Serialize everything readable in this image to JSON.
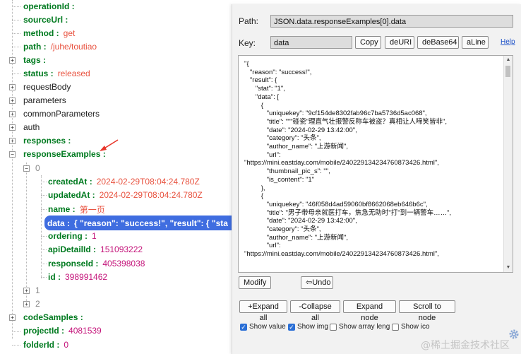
{
  "tree": {
    "operationId": {
      "key": "operationId :"
    },
    "sourceUrl": {
      "key": "sourceUrl :"
    },
    "method": {
      "key": "method :",
      "value": "get"
    },
    "path": {
      "key": "path :",
      "value": "/juhe/toutiao"
    },
    "tags": {
      "key": "tags :"
    },
    "status": {
      "key": "status :",
      "value": "released"
    },
    "requestBody": {
      "key": "requestBody"
    },
    "parameters": {
      "key": "parameters"
    },
    "commonParameters": {
      "key": "commonParameters"
    },
    "auth": {
      "key": "auth"
    },
    "responses": {
      "key": "responses :"
    },
    "responseExamples": {
      "key": "responseExamples :"
    },
    "index0": {
      "key": "0"
    },
    "createdAt": {
      "key": "createdAt :",
      "value": "2024-02-29T08:04:24.780Z"
    },
    "updatedAt": {
      "key": "updatedAt :",
      "value": "2024-02-29T08:04:24.780Z"
    },
    "name": {
      "key": "name :",
      "value": "第一页"
    },
    "data": {
      "key": "data :",
      "value": "{ \"reason\": \"success!\", \"result\": { \"sta"
    },
    "ordering": {
      "key": "ordering :",
      "value": "1"
    },
    "apiDetailId": {
      "key": "apiDetailId :",
      "value": "151093222"
    },
    "responseId": {
      "key": "responseId :",
      "value": "405398038"
    },
    "id": {
      "key": "id :",
      "value": "398991462"
    },
    "index1": {
      "key": "1"
    },
    "index2": {
      "key": "2"
    },
    "codeSamples": {
      "key": "codeSamples :"
    },
    "projectId": {
      "key": "projectId :",
      "value": "4081539"
    },
    "folderId": {
      "key": "folderId :",
      "value": "0"
    }
  },
  "panel": {
    "path_label": "Path:",
    "path_value": "JSON.data.responseExamples[0].data",
    "key_label": "Key:",
    "key_value": "data",
    "copy_button": "Copy",
    "deuri_button": "deURI",
    "debase64_button": "deBase64",
    "aline_button": "aLine",
    "help_link": "Help",
    "code_text": "\"{\n   \"reason\": \"success!\",\n   \"result\": {\n      \"stat\": \"1\",\n      \"data\": [\n         {\n            \"uniquekey\": \"9cf154de8302fab96c7ba5736d5ac068\",\n            \"title\": \"\"\"碰瓷\"理直气壮报警反称车被盗？真相让人啼笑皆非\",\n            \"date\": \"2024-02-29 13:42:00\",\n            \"category\": \"头条\",\n            \"author_name\": \"上游新闻\",\n            \"url\":\n\"https://mini.eastday.com/mobile/240229134234760873426.html\",\n            \"thumbnail_pic_s\": \"\",\n            \"is_content\": \"1\"\n         },\n         {\n            \"uniquekey\": \"46f058d4ad59060bf8662068eb646b6c\",\n            \"title\": \"男子带母亲就医打车，焦急无助时\"打\"到一辆警车……\",\n            \"date\": \"2024-02-29 13:42:00\",\n            \"category\": \"头条\",\n            \"author_name\": \"上游新闻\",\n            \"url\":\n\"https://mini.eastday.com/mobile/240229134234760873426.html\",",
    "modify_button": "Modify",
    "undo_button": "⇦Undo",
    "expand_all_button": "+Expand all",
    "collapse_all_button": "-Collapse all",
    "expand_node_button": "Expand node",
    "scroll_to_node_button": "Scroll to node",
    "show_value": {
      "label": "Show value",
      "checked": true
    },
    "show_img": {
      "label": "Show img",
      "checked": true
    },
    "show_array_leng": {
      "label": "Show array leng",
      "checked": false
    },
    "show_ico": {
      "label": "Show ico",
      "checked": false
    }
  },
  "watermark": "@稀土掘金技术社区",
  "icons": {
    "expander_plus": "plus-square-icon",
    "expander_minus": "minus-square-icon",
    "arrow": "red-arrow-icon",
    "gear": "gear-icon"
  },
  "colors": {
    "key_green": "#007a1f",
    "value_red": "#e8523f",
    "selected_blue": "#3f6de0"
  }
}
